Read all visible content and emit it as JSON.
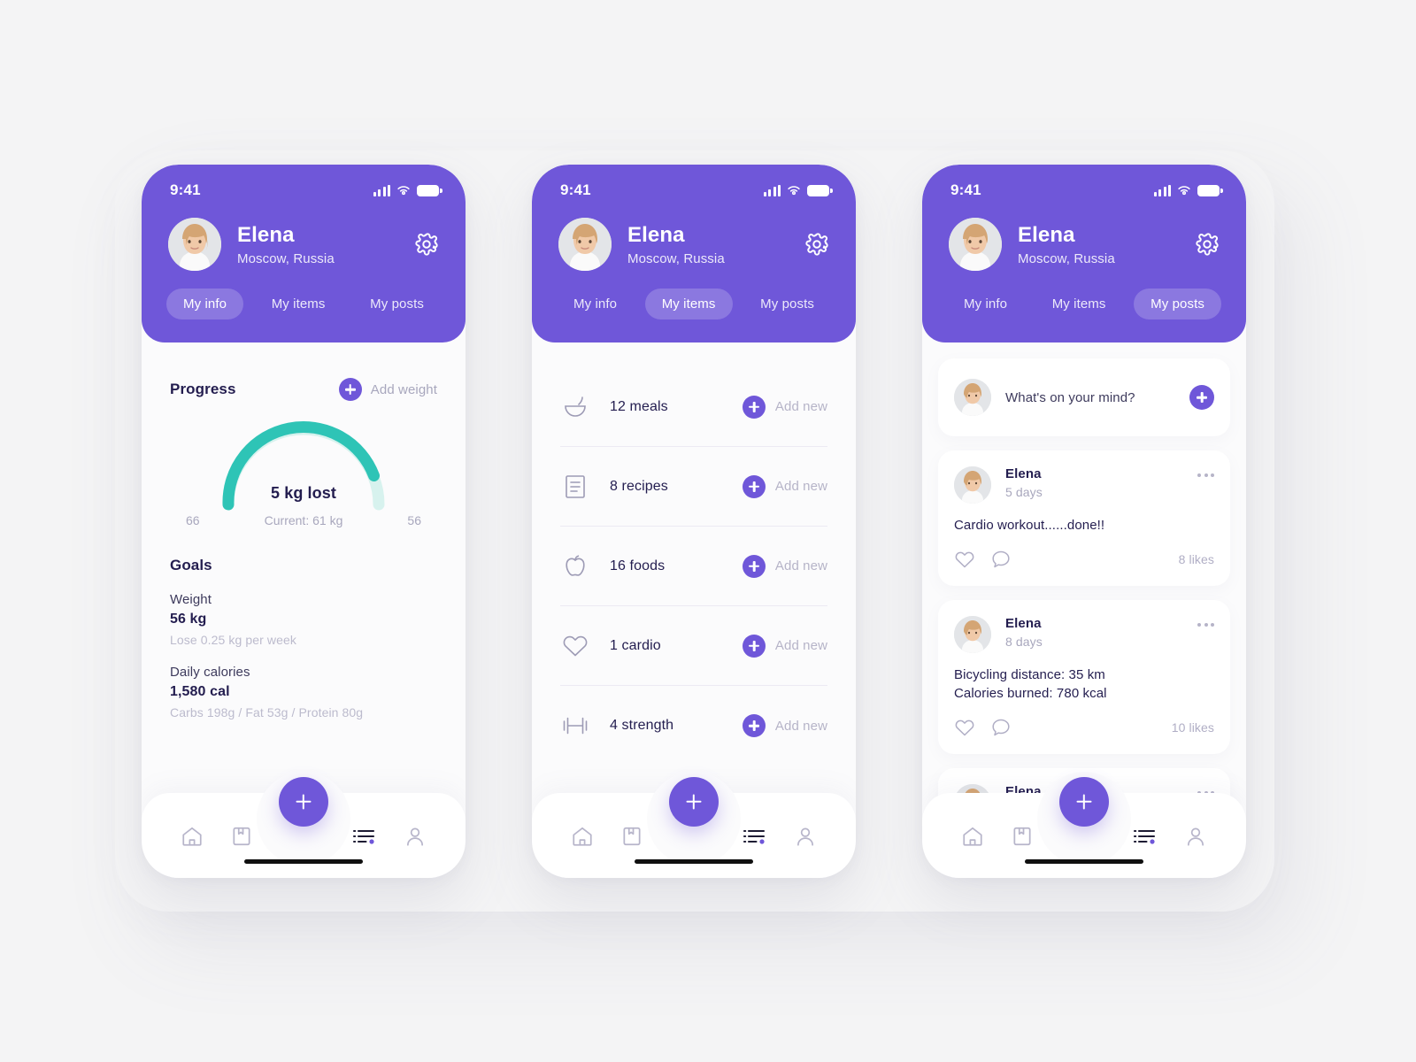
{
  "theme": {
    "purple": "#6f57d9",
    "teal": "#2ec4b6",
    "teal_track": "#d7f2ee",
    "bg": "#f4f4f5",
    "text_dark": "#231d4f",
    "text_muted": "#a8a7bd"
  },
  "status_bar": {
    "time": "9:41",
    "signal_icon": "signal-bars-icon",
    "wifi_icon": "wifi-icon",
    "battery_icon": "battery-icon"
  },
  "profile": {
    "name": "Elena",
    "location": "Moscow, Russia",
    "avatar_icon": "user-avatar-photo",
    "settings_icon": "gear-icon"
  },
  "tabs": [
    {
      "label": "My info"
    },
    {
      "label": "My items"
    },
    {
      "label": "My posts"
    }
  ],
  "screens": [
    {
      "active_tab": "My info"
    },
    {
      "active_tab": "My items"
    },
    {
      "active_tab": "My posts"
    }
  ],
  "screen1": {
    "progress": {
      "title": "Progress",
      "add_label": "Add weight",
      "add_icon": "plus-circle-icon",
      "center_text": "5 kg lost",
      "start_label": "66",
      "current_label": "Current: 61 kg",
      "end_label": "56"
    },
    "goals": {
      "title": "Goals",
      "entries": [
        {
          "label": "Weight",
          "value": "56 kg",
          "sub": "Lose 0.25 kg per week"
        },
        {
          "label": "Daily calories",
          "value": "1,580 cal",
          "sub": "Carbs 198g / Fat 53g / Protein 80g"
        }
      ]
    }
  },
  "screen2": {
    "items": [
      {
        "icon": "bowl-icon",
        "label": "12 meals",
        "action": "Add new",
        "action_icon": "plus-circle-icon"
      },
      {
        "icon": "document-icon",
        "label": "8 recipes",
        "action": "Add new",
        "action_icon": "plus-circle-icon"
      },
      {
        "icon": "apple-icon",
        "label": "16 foods",
        "action": "Add new",
        "action_icon": "plus-circle-icon"
      },
      {
        "icon": "heart-icon",
        "label": "1 cardio",
        "action": "Add new",
        "action_icon": "plus-circle-icon"
      },
      {
        "icon": "dumbbell-icon",
        "label": "4 strength",
        "action": "Add new",
        "action_icon": "plus-circle-icon"
      }
    ]
  },
  "screen3": {
    "composer": {
      "placeholder": "What's on your mind?",
      "avatar_icon": "user-avatar-photo",
      "add_icon": "plus-circle-icon"
    },
    "posts": [
      {
        "author": "Elena",
        "time": "5 days",
        "text": "Cardio workout......done!!",
        "likes": "8 likes",
        "menu_icon": "more-horizontal-icon",
        "like_icon": "heart-icon",
        "comment_icon": "comment-icon"
      },
      {
        "author": "Elena",
        "time": "8 days",
        "text": "Bicycling distance: 35 km\nCalories burned: 780 kcal",
        "likes": "10 likes",
        "menu_icon": "more-horizontal-icon",
        "like_icon": "heart-icon",
        "comment_icon": "comment-icon"
      },
      {
        "author": "Elena",
        "time": "",
        "text": "",
        "likes": "",
        "menu_icon": "more-horizontal-icon",
        "like_icon": "heart-icon",
        "comment_icon": "comment-icon"
      }
    ]
  },
  "bottom_nav": {
    "fab_icon": "plus-icon",
    "items": [
      {
        "icon": "home-icon",
        "active": false
      },
      {
        "icon": "book-icon",
        "active": false
      },
      {
        "icon": "list-icon",
        "active": true
      },
      {
        "icon": "person-icon",
        "active": false
      }
    ]
  },
  "chart_data": {
    "type": "gauge",
    "title": "Progress",
    "center_label": "5 kg lost",
    "start_value": 66,
    "end_value": 56,
    "current_value": 61,
    "unit": "kg",
    "percent_complete": 77,
    "track_color": "#d7f2ee",
    "progress_color": "#2ec4b6",
    "start_tick_label": "66",
    "end_tick_label": "56",
    "current_tick_label": "Current: 61 kg"
  }
}
